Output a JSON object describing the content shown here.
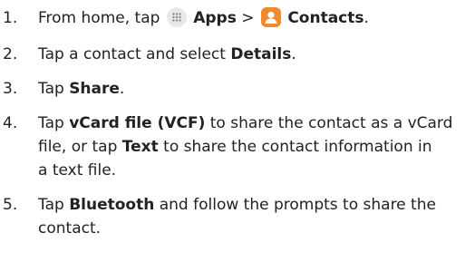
{
  "steps": [
    {
      "number": "1.",
      "text_before": "From home, tap",
      "apps_label": "Apps",
      "separator": ">",
      "contacts_label": "Contacts",
      "text_after": ".",
      "icons": [
        "apps-grid-icon",
        "contacts-icon"
      ]
    },
    {
      "number": "2.",
      "text_before": "Tap a contact and select",
      "bold": "Details",
      "text_after": "."
    },
    {
      "number": "3.",
      "text_before": "Tap",
      "bold": "Share",
      "text_after": "."
    },
    {
      "number": "4.",
      "line1_before": "Tap",
      "bold1": "vCard file (VCF)",
      "line1_after": "to share the contact as a vCard",
      "line2_before": "file, or tap",
      "bold2": "Text",
      "line2_after": "to share the contact information in",
      "line3": "a text file."
    },
    {
      "number": "5.",
      "line1_before": "Tap",
      "bold": "Bluetooth",
      "line1_after": "and follow the prompts to share the",
      "line2": "contact."
    }
  ],
  "colors": {
    "text": "#222222",
    "apps_icon_bg": "#e8e8e8",
    "contacts_icon_bg": "#f08a2a"
  }
}
